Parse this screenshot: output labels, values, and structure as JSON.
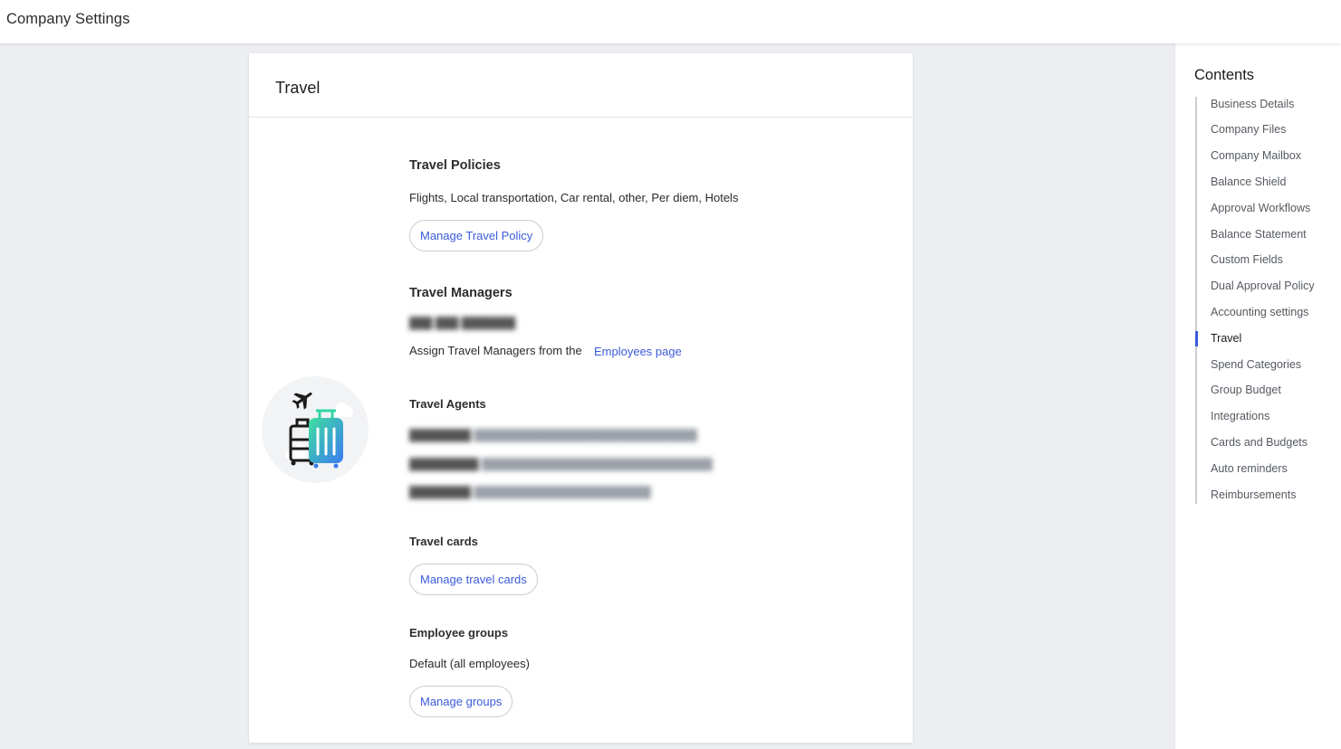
{
  "app": {
    "title": "Company Settings"
  },
  "card": {
    "title": "Travel",
    "policies": {
      "title": "Travel Policies",
      "description": "Flights, Local transportation, Car rental, other, Per diem, Hotels",
      "button": "Manage Travel Policy"
    },
    "managers": {
      "title": "Travel Managers",
      "assign_text": "Assign Travel Managers from the",
      "assign_link": "Employees page"
    },
    "agents": {
      "title": "Travel Agents"
    },
    "cards": {
      "title": "Travel cards",
      "button": "Manage travel cards"
    },
    "groups": {
      "title": "Employee groups",
      "value": "Default (all employees)",
      "button": "Manage groups"
    }
  },
  "sidebar": {
    "heading": "Contents",
    "active": "Travel",
    "items": [
      "Business Details",
      "Company Files",
      "Company Mailbox",
      "Balance Shield",
      "Approval Workflows",
      "Balance Statement",
      "Custom Fields",
      "Dual Approval Policy",
      "Accounting settings",
      "Travel",
      "Spend Categories",
      "Group Budget",
      "Integrations",
      "Cards and Budgets",
      "Auto reminders",
      "Reimbursements"
    ]
  },
  "colors": {
    "accent": "#3b5bdb",
    "background": "#eceef1"
  },
  "icons": [
    "airplane-icon",
    "luggage-icon",
    "cloud-icon"
  ]
}
